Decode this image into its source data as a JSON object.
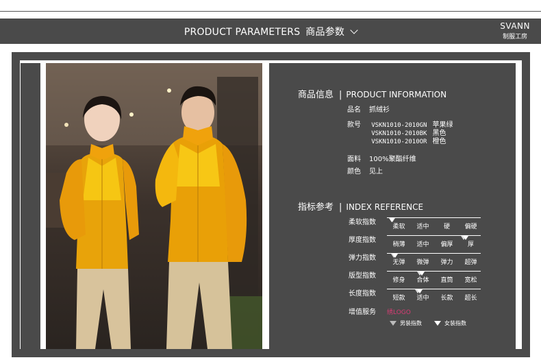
{
  "header": {
    "title_en": "PRODUCT PARAMETERS",
    "title_cn": "商品参数",
    "brand_name": "SVANN",
    "brand_sub": "制服工房"
  },
  "product_info": {
    "title_cn": "商品信息",
    "separator": "|",
    "title_en": "PRODUCT INFORMATION",
    "name_label": "品名",
    "name_value": "抓绒衫",
    "sku_label": "款号",
    "skus": [
      {
        "code": "VSKN1010-2010GN",
        "color": "苹果绿"
      },
      {
        "code": "VSKN1010-2010BK",
        "color": "黑色"
      },
      {
        "code": "VSKN1010-2010OR",
        "color": "橙色"
      }
    ],
    "fabric_label": "面料",
    "fabric_value": "100%聚酯纤维",
    "color_label": "颜色",
    "color_value": "见上"
  },
  "index_ref": {
    "title_cn": "指标参考",
    "separator": "|",
    "title_en": "INDEX REFERENCE",
    "rows": [
      {
        "label": "柔软指数",
        "options": [
          "柔软",
          "适中",
          "硬",
          "偏硬"
        ],
        "mens_level": 0.06,
        "womens_level": 0.05
      },
      {
        "label": "厚度指数",
        "options": [
          "稍薄",
          "适中",
          "偏厚",
          "厚"
        ],
        "mens_level": 0.82,
        "womens_level": 0.84
      },
      {
        "label": "弹力指数",
        "options": [
          "无弹",
          "微弹",
          "弹力",
          "超弹"
        ],
        "mens_level": 0.07,
        "womens_level": 0.09
      },
      {
        "label": "版型指数",
        "options": [
          "修身",
          "合体",
          "直筒",
          "宽松"
        ],
        "mens_level": 0.35,
        "womens_level": 0.37
      },
      {
        "label": "长度指数",
        "options": [
          "短款",
          "适中",
          "长款",
          "超长"
        ],
        "mens_level": 0.33,
        "womens_level": 0.35
      }
    ],
    "addon_label": "增值服务",
    "addon_value": "绣LOGO",
    "addon_color": "#d63c73",
    "legend_mens": "男装指数",
    "legend_womens": "女装指数"
  }
}
